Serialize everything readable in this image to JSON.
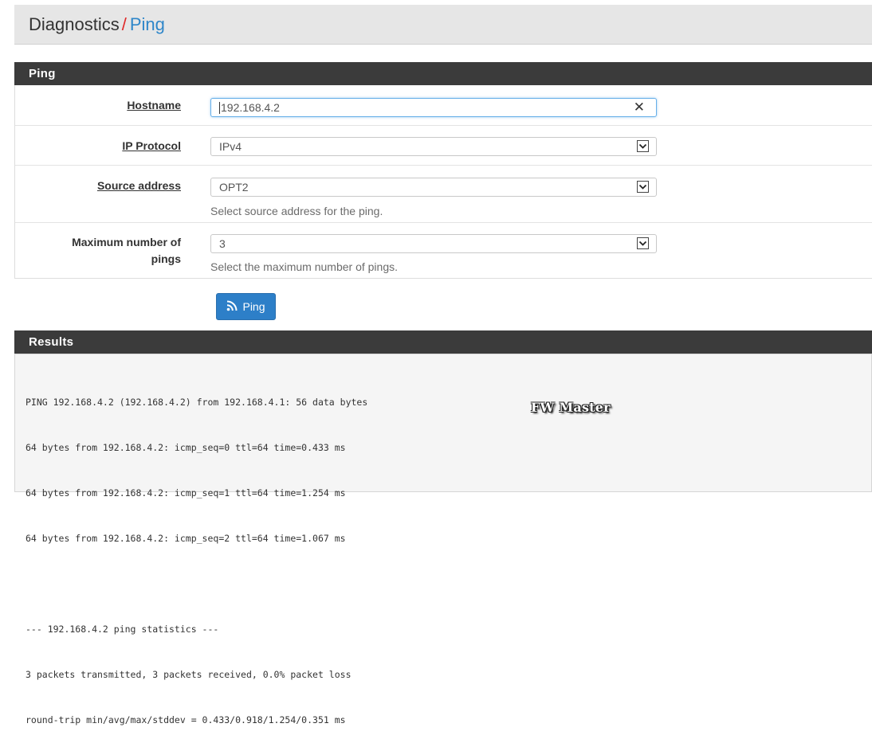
{
  "breadcrumb": {
    "root": "Diagnostics",
    "separator": "/",
    "current": "Ping"
  },
  "ping_panel": {
    "title": "Ping",
    "hostname": {
      "label": "Hostname",
      "value": "192.168.4.2",
      "clear_icon": "close-icon"
    },
    "ip_protocol": {
      "label": "IP Protocol",
      "selected": "IPv4"
    },
    "source_address": {
      "label": "Source address",
      "selected": "OPT2",
      "help": "Select source address for the ping."
    },
    "max_pings": {
      "label_line1": "Maximum number of",
      "label_line2": "pings",
      "selected": "3",
      "help": "Select the maximum number of pings."
    }
  },
  "ping_button": {
    "label": "Ping",
    "icon": "rss-icon",
    "color": "#2d7fc8"
  },
  "results_panel": {
    "title": "Results",
    "lines": [
      "PING 192.168.4.2 (192.168.4.2) from 192.168.4.1: 56 data bytes",
      "64 bytes from 192.168.4.2: icmp_seq=0 ttl=64 time=0.433 ms",
      "64 bytes from 192.168.4.2: icmp_seq=1 ttl=64 time=1.254 ms",
      "64 bytes from 192.168.4.2: icmp_seq=2 ttl=64 time=1.067 ms",
      "",
      "--- 192.168.4.2 ping statistics ---",
      "3 packets transmitted, 3 packets received, 0.0% packet loss",
      "round-trip min/avg/max/stddev = 0.433/0.918/1.254/0.351 ms"
    ]
  },
  "watermark": "FW Master",
  "colors": {
    "accent": "#2e86c9",
    "separator": "#e02a2a",
    "panel_heading": "#3b3b3b"
  }
}
